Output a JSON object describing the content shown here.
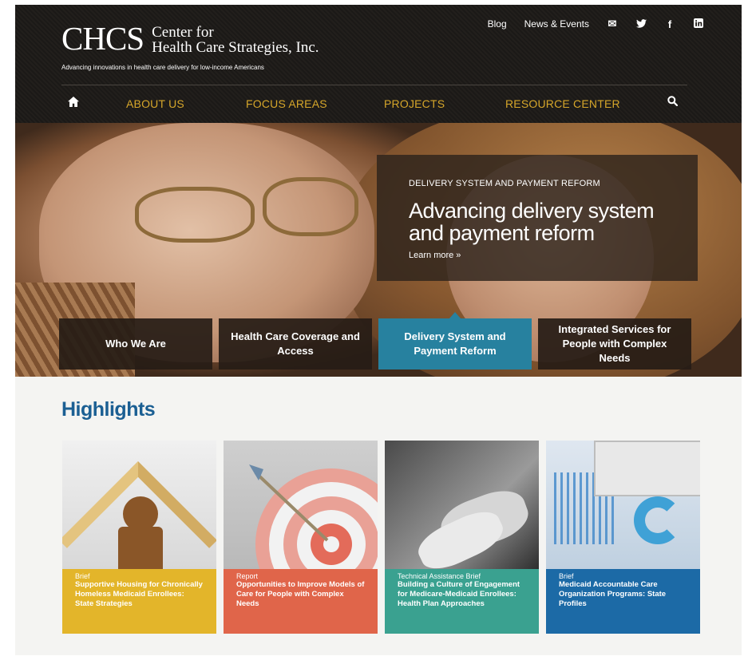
{
  "brand": {
    "mark": "CHCS",
    "name_line1": "Center for",
    "name_line2": "Health Care Strategies, Inc.",
    "tagline": "Advancing innovations in health care delivery for low-income Americans"
  },
  "utility_nav": {
    "links": [
      "Blog",
      "News & Events"
    ],
    "icons": [
      "mail-icon",
      "twitter-icon",
      "facebook-icon",
      "linkedin-icon"
    ]
  },
  "main_nav": {
    "home_icon": "home-icon",
    "items": [
      "ABOUT US",
      "FOCUS AREAS",
      "PROJECTS",
      "RESOURCE CENTER"
    ],
    "search_icon": "search-icon"
  },
  "hero": {
    "kicker": "DELIVERY SYSTEM AND PAYMENT REFORM",
    "title": "Advancing delivery system and payment reform",
    "link": "Learn more »",
    "tiles": [
      {
        "label": "Who We Are",
        "active": false
      },
      {
        "label": "Health Care Coverage and Access",
        "active": false
      },
      {
        "label": "Delivery System and Payment Reform",
        "active": true
      },
      {
        "label": "Integrated Services for People with Complex Needs",
        "active": false
      }
    ]
  },
  "highlights": {
    "heading": "Highlights",
    "cards": [
      {
        "type": "Brief",
        "title": "Supportive Housing for Chronically Homeless Medicaid Enrollees: State Strategies",
        "color": "#e3b52a"
      },
      {
        "type": "Report",
        "title": "Opportunities to Improve Models of Care for People with Complex Needs",
        "color": "#e0654a"
      },
      {
        "type": "Technical Assistance Brief",
        "title": "Building a Culture of Engagement for Medicare-Medicaid Enrollees: Health Plan Approaches",
        "color": "#3aa190"
      },
      {
        "type": "Brief",
        "title": "Medicaid Accountable Care Organization Programs: State Profiles",
        "color": "#1c6aa6"
      }
    ]
  },
  "colors": {
    "nav_gold": "#d6a62a",
    "active_tile": "#27819f",
    "heading_blue": "#1b5f93"
  }
}
